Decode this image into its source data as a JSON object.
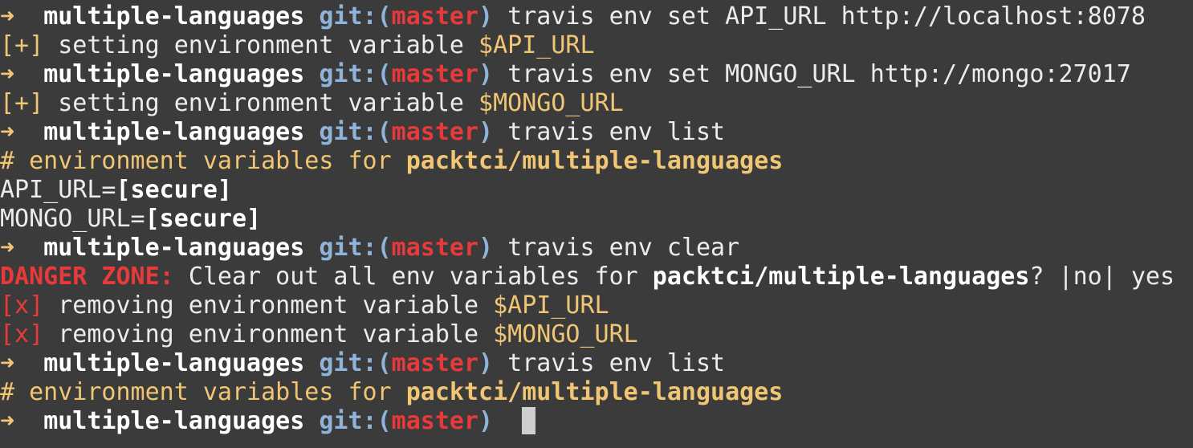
{
  "prompt": {
    "arrow": "➜",
    "directory": "multiple-languages",
    "git_prefix": "git:(",
    "branch": "master",
    "git_suffix": ")"
  },
  "lines": [
    {
      "kind": "prompt",
      "command": "travis env set API_URL http://localhost:8078"
    },
    {
      "kind": "status",
      "marker": "[+]",
      "text": "setting environment variable",
      "var": "$API_URL"
    },
    {
      "kind": "prompt",
      "command": "travis env set MONGO_URL http://mongo:27017"
    },
    {
      "kind": "status",
      "marker": "[+]",
      "text": "setting environment variable",
      "var": "$MONGO_URL"
    },
    {
      "kind": "prompt",
      "command": "travis env list"
    },
    {
      "kind": "comment",
      "text": "# environment variables for",
      "repo": "packtci/multiple-languages"
    },
    {
      "kind": "envvar",
      "name": "API_URL=",
      "value": "[secure]"
    },
    {
      "kind": "envvar",
      "name": "MONGO_URL=",
      "value": "[secure]"
    },
    {
      "kind": "prompt",
      "command": "travis env clear"
    },
    {
      "kind": "danger",
      "label": "DANGER ZONE:",
      "text": "Clear out all env variables for",
      "repo": "packtci/multiple-languages",
      "question": "? |no| yes"
    },
    {
      "kind": "removal",
      "marker": "[x]",
      "text": "removing environment variable",
      "var": "$API_URL"
    },
    {
      "kind": "removal",
      "marker": "[x]",
      "text": "removing environment variable",
      "var": "$MONGO_URL"
    },
    {
      "kind": "prompt",
      "command": "travis env list"
    },
    {
      "kind": "comment",
      "text": "# environment variables for",
      "repo": "packtci/multiple-languages"
    },
    {
      "kind": "prompt",
      "command": ""
    }
  ],
  "colors": {
    "background": "#3b3b3b",
    "foreground": "#ececec",
    "yellow": "#f0c674",
    "red": "#e83a3a",
    "blue": "#8fb3d9",
    "cursor": "#cfcfcf"
  }
}
